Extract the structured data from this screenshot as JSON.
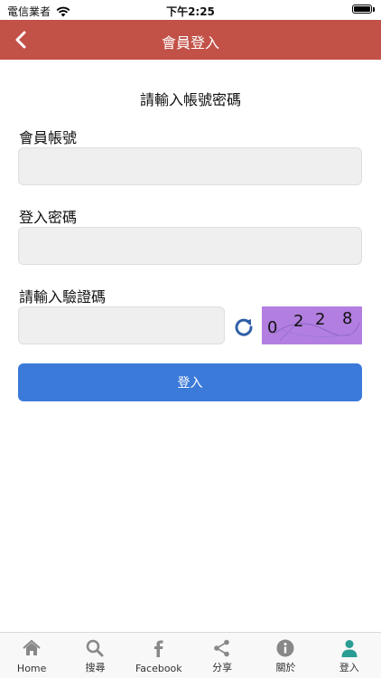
{
  "status_bar": {
    "carrier": "電信業者",
    "time": "下午2:25"
  },
  "nav": {
    "title": "會員登入"
  },
  "form": {
    "heading": "請輸入帳號密碼",
    "account_label": "會員帳號",
    "password_label": "登入密碼",
    "captcha_label": "請輸入驗證碼",
    "captcha_digits": [
      "0",
      "2",
      "2",
      "8"
    ],
    "login_label": "登入"
  },
  "tabs": [
    {
      "label": "Home",
      "icon": "home-icon"
    },
    {
      "label": "搜尋",
      "icon": "search-icon"
    },
    {
      "label": "Facebook",
      "icon": "facebook-icon"
    },
    {
      "label": "分享",
      "icon": "share-icon"
    },
    {
      "label": "關於",
      "icon": "info-icon"
    },
    {
      "label": "登入",
      "icon": "user-icon"
    }
  ],
  "colors": {
    "nav_bg": "#c25147",
    "button_bg": "#3b7ad9",
    "captcha_bg": "#b27fe0",
    "active_tab": "#2a9d93"
  }
}
